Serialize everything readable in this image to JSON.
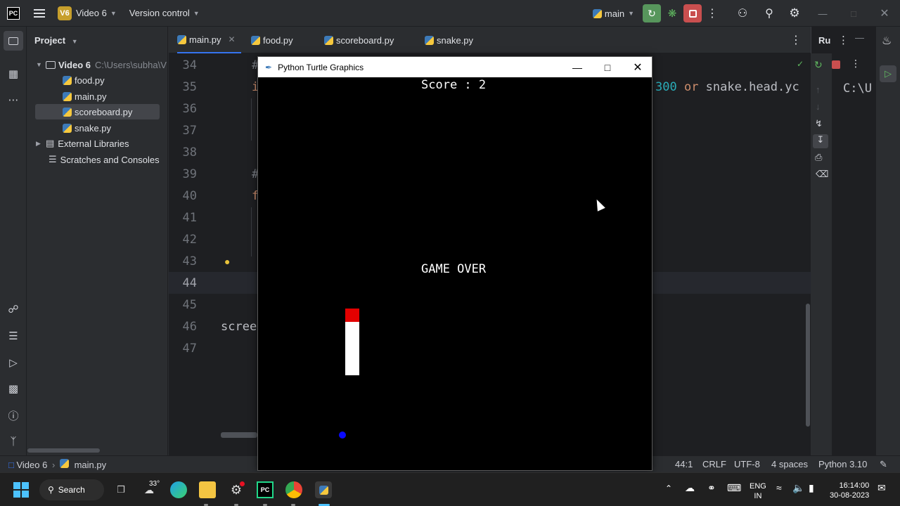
{
  "titlebar": {
    "logo": "PC",
    "project_badge": "V6",
    "project_name": "Video 6",
    "vcs_label": "Version control",
    "branch": "main",
    "colors": {
      "run_green": "#57965c",
      "stop_red": "#c94f4f",
      "badge": "#c79f2c"
    }
  },
  "project_panel": {
    "title": "Project",
    "root": {
      "name": "Video 6",
      "path": "C:\\Users\\subha\\V"
    },
    "files": [
      "food.py",
      "main.py",
      "scoreboard.py",
      "snake.py"
    ],
    "selected_file": "scoreboard.py",
    "external_libraries": "External Libraries",
    "scratches": "Scratches and Consoles"
  },
  "tabs": [
    {
      "label": "main.py",
      "active": true
    },
    {
      "label": "food.py",
      "active": false
    },
    {
      "label": "scoreboard.py",
      "active": false
    },
    {
      "label": "snake.py",
      "active": false
    }
  ],
  "editor": {
    "line_numbers": [
      "34",
      "35",
      "36",
      "37",
      "38",
      "39",
      "40",
      "41",
      "42",
      "43",
      "44",
      "45",
      "46",
      "47"
    ],
    "current_line": "44",
    "visible_code": {
      "line34": "#",
      "line35": "i",
      "line35_right": "300 or snake.head.yc",
      "line39": "#",
      "line40": "f",
      "line46": "scree"
    }
  },
  "run_panel": {
    "title": "Ru",
    "output": "C:\\U"
  },
  "turtle_window": {
    "title": "Python Turtle Graphics",
    "score_text": "Score : 2",
    "game_over_text": "GAME OVER",
    "colors": {
      "snake_head": "#e30000",
      "snake_body": "#ffffff",
      "food": "#0a0aff",
      "background": "#000000"
    }
  },
  "statusbar": {
    "breadcrumb_project": "Video 6",
    "breadcrumb_file": "main.py",
    "position": "44:1",
    "line_sep": "CRLF",
    "encoding": "UTF-8",
    "indent": "4 spaces",
    "interpreter": "Python 3.10"
  },
  "taskbar": {
    "search_label": "Search",
    "weather": "33°",
    "language_top": "ENG",
    "language_bottom": "IN",
    "time": "16:14:00",
    "date": "30-08-2023"
  }
}
